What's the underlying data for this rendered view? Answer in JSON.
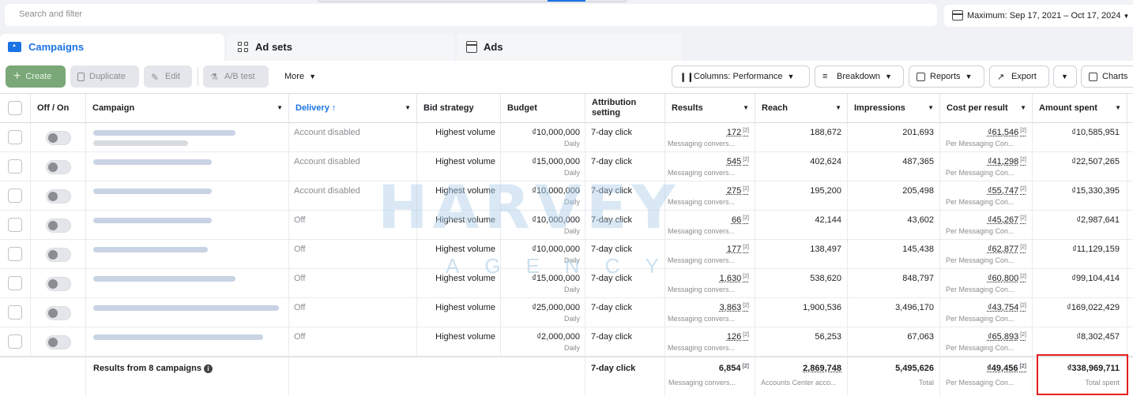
{
  "search": {
    "placeholder": "Search and filter"
  },
  "date_range": {
    "label": "Maximum: Sep 17, 2021 – Oct 17, 2024"
  },
  "tabs": [
    {
      "label": "Campaigns",
      "icon": "folder-icon",
      "active": true
    },
    {
      "label": "Ad sets",
      "icon": "grid-icon",
      "active": false
    },
    {
      "label": "Ads",
      "icon": "document-icon",
      "active": false
    }
  ],
  "toolbar": {
    "create": "Create",
    "duplicate": "Duplicate",
    "edit": "Edit",
    "ab_test": "A/B test",
    "more": "More",
    "columns": "Columns: Performance",
    "breakdown": "Breakdown",
    "reports": "Reports",
    "export": "Export",
    "charts": "Charts"
  },
  "columns": {
    "off_on": "Off / On",
    "campaign": "Campaign",
    "delivery": "Delivery ↑",
    "bid_strategy": "Bid strategy",
    "budget": "Budget",
    "attribution": "Attribution setting",
    "results": "Results",
    "reach": "Reach",
    "impressions": "Impressions",
    "cost_per_result": "Cost per result",
    "amount_spent": "Amount spent"
  },
  "rows": [
    {
      "delivery": "Account disabled",
      "bid": "Highest volume",
      "budget": "₫10,000,000",
      "budget_period": "Daily",
      "attribution": "7-day click",
      "results": "172",
      "results_sub": "Messaging convers...",
      "reach": "188,672",
      "impressions": "201,693",
      "cpr": "₫61,546",
      "cpr_sub": "Per Messaging Con...",
      "spent": "₫10,585,951"
    },
    {
      "delivery": "Account disabled",
      "bid": "Highest volume",
      "budget": "₫15,000,000",
      "budget_period": "Daily",
      "attribution": "7-day click",
      "results": "545",
      "results_sub": "Messaging convers...",
      "reach": "402,624",
      "impressions": "487,365",
      "cpr": "₫41,298",
      "cpr_sub": "Per Messaging Con...",
      "spent": "₫22,507,265"
    },
    {
      "delivery": "Account disabled",
      "bid": "Highest volume",
      "budget": "₫10,000,000",
      "budget_period": "Daily",
      "attribution": "7-day click",
      "results": "275",
      "results_sub": "Messaging convers...",
      "reach": "195,200",
      "impressions": "205,498",
      "cpr": "₫55,747",
      "cpr_sub": "Per Messaging Con...",
      "spent": "₫15,330,395"
    },
    {
      "delivery": "Off",
      "bid": "Highest volume",
      "budget": "₫10,000,000",
      "budget_period": "Daily",
      "attribution": "7-day click",
      "results": "66",
      "results_sub": "Messaging convers...",
      "reach": "42,144",
      "impressions": "43,602",
      "cpr": "₫45,267",
      "cpr_sub": "Per Messaging Con...",
      "spent": "₫2,987,641"
    },
    {
      "delivery": "Off",
      "bid": "Highest volume",
      "budget": "₫10,000,000",
      "budget_period": "Daily",
      "attribution": "7-day click",
      "results": "177",
      "results_sub": "Messaging convers...",
      "reach": "138,497",
      "impressions": "145,438",
      "cpr": "₫62,877",
      "cpr_sub": "Per Messaging Con...",
      "spent": "₫11,129,159"
    },
    {
      "delivery": "Off",
      "bid": "Highest volume",
      "budget": "₫15,000,000",
      "budget_period": "Daily",
      "attribution": "7-day click",
      "results": "1,630",
      "results_sub": "Messaging convers...",
      "reach": "538,620",
      "impressions": "848,797",
      "cpr": "₫60,800",
      "cpr_sub": "Per Messaging Con...",
      "spent": "₫99,104,414"
    },
    {
      "delivery": "Off",
      "bid": "Highest volume",
      "budget": "₫25,000,000",
      "budget_period": "Daily",
      "attribution": "7-day click",
      "results": "3,863",
      "results_sub": "Messaging convers...",
      "reach": "1,900,536",
      "impressions": "3,496,170",
      "cpr": "₫43,754",
      "cpr_sub": "Per Messaging Con...",
      "spent": "₫169,022,429"
    },
    {
      "delivery": "Off",
      "bid": "Highest volume",
      "budget": "₫2,000,000",
      "budget_period": "Daily",
      "attribution": "7-day click",
      "results": "126",
      "results_sub": "Messaging convers...",
      "reach": "56,253",
      "impressions": "67,063",
      "cpr": "₫65,893",
      "cpr_sub": "Per Messaging Con...",
      "spent": "₫8,302,457"
    }
  ],
  "totals": {
    "label": "Results from 8 campaigns",
    "attribution": "7-day click",
    "results": "6,854",
    "results_sub": "Messaging convers...",
    "reach": "2,869,748",
    "reach_sub": "Accounts Center acco...",
    "impressions": "5,495,626",
    "impressions_sub": "Total",
    "cpr": "₫49,456",
    "cpr_sub": "Per Messaging Con...",
    "spent": "₫338,969,711",
    "spent_sub": "Total spent"
  },
  "watermark": {
    "title": "HARVEY",
    "subtitle": "AGENCY"
  },
  "colors": {
    "accent": "#1b74e4",
    "highlight_box": "#e41e1e",
    "create_button": "#7aa878"
  }
}
